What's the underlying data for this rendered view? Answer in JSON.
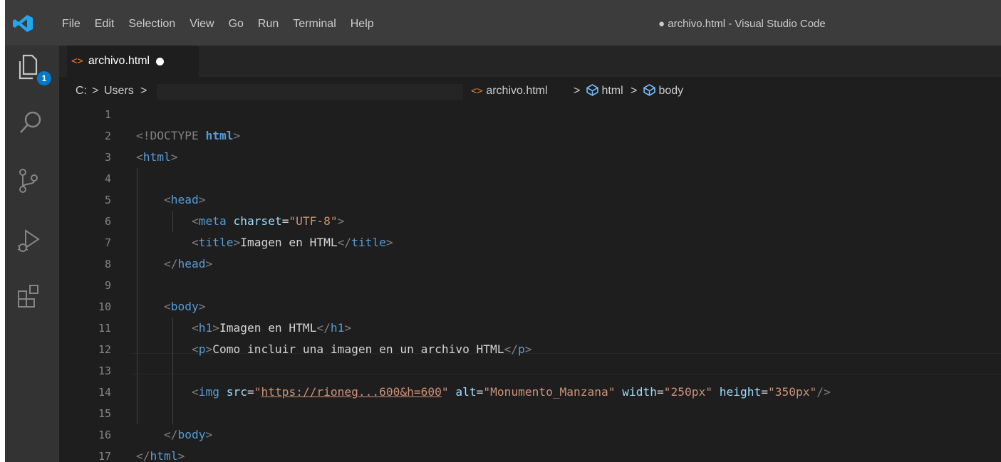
{
  "window": {
    "title": "● archivo.html - Visual Studio Code"
  },
  "menu": [
    "File",
    "Edit",
    "Selection",
    "View",
    "Go",
    "Run",
    "Terminal",
    "Help"
  ],
  "activity_bar": {
    "items": [
      "explorer-icon",
      "search-icon",
      "source-control-icon",
      "run-debug-icon",
      "extensions-icon"
    ],
    "explorer_badge": "1",
    "badge_color": "#007acc"
  },
  "tab": {
    "icon": "<>",
    "label": "archivo.html"
  },
  "breadcrumbs": {
    "drive": "C:",
    "users": "Users",
    "sep": ">",
    "file_icon": "<>",
    "file": "archivo.html",
    "html": "html",
    "body": "body"
  },
  "editor": {
    "language": "html",
    "line_numbers": [
      "1",
      "2",
      "3",
      "4",
      "5",
      "6",
      "7",
      "8",
      "9",
      "10",
      "11",
      "12",
      "13",
      "14",
      "15",
      "16",
      "17"
    ],
    "lines": [
      "",
      "<!DOCTYPE html>",
      "<html>",
      "",
      "    <head>",
      "        <meta charset=\"UTF-8\">",
      "        <title>Imagen en HTML</title>",
      "    </head>",
      "",
      "    <body>",
      "        <h1>Imagen en HTML</h1>",
      "        <p>Como incluir una imagen en un archivo HTML</p>",
      "",
      "        <img src=\"https://rioneg...600&h=600\" alt=\"Monumento_Manzana\" width=\"250px\" height=\"350px\"/>",
      "",
      "    </body>",
      "</html>"
    ],
    "current_line": "13",
    "tokens": {
      "doctype_open": "<!DOCTYPE",
      "doctype_html": "html",
      "gt": ">",
      "lt": "<",
      "lt_slash": "</",
      "slash_gt": "/>",
      "eq": "=",
      "tag_html": "html",
      "tag_head": "head",
      "tag_meta": "meta",
      "attr_charset": "charset",
      "val_charset": "\"UTF-8\"",
      "tag_title": "title",
      "title_text": "Imagen en HTML",
      "tag_body": "body",
      "tag_h1": "h1",
      "h1_text": "Imagen en HTML",
      "tag_p": "p",
      "p_text": "Como incluir una imagen en un archivo HTML",
      "tag_img": "img",
      "attr_src": "src",
      "q": "\"",
      "src_url": "https://rioneg...600&h=600",
      "attr_alt": "alt",
      "val_alt": "\"Monumento_Manzana\"",
      "attr_width": "width",
      "val_width": "\"250px\"",
      "attr_height": "height",
      "val_height": "\"350px\""
    }
  },
  "colors": {
    "tag": "#569cd6",
    "attribute": "#9cdcfe",
    "string": "#ce9178",
    "bracket": "#808080",
    "text": "#d4d4d4",
    "line_number": "#858585",
    "html_file_icon": "#e37933"
  }
}
